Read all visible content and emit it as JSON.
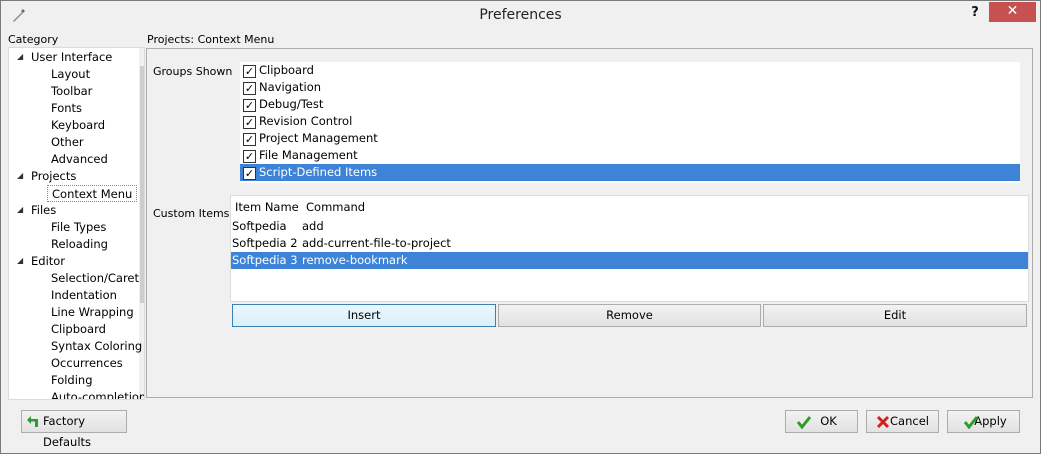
{
  "window": {
    "title": "Preferences",
    "help": "?",
    "close": "✕"
  },
  "category": {
    "label": "Category",
    "items": [
      {
        "text": "User Interface",
        "level": 0,
        "expanded": true
      },
      {
        "text": "Layout",
        "level": 1
      },
      {
        "text": "Toolbar",
        "level": 1
      },
      {
        "text": "Fonts",
        "level": 1
      },
      {
        "text": "Keyboard",
        "level": 1
      },
      {
        "text": "Other",
        "level": 1
      },
      {
        "text": "Advanced",
        "level": 1
      },
      {
        "text": "Projects",
        "level": 0,
        "expanded": true
      },
      {
        "text": "Context Menu",
        "level": 1,
        "selected": true
      },
      {
        "text": "Files",
        "level": 0,
        "expanded": true
      },
      {
        "text": "File Types",
        "level": 1
      },
      {
        "text": "Reloading",
        "level": 1
      },
      {
        "text": "Editor",
        "level": 0,
        "expanded": true
      },
      {
        "text": "Selection/Caret",
        "level": 1
      },
      {
        "text": "Indentation",
        "level": 1
      },
      {
        "text": "Line Wrapping",
        "level": 1
      },
      {
        "text": "Clipboard",
        "level": 1
      },
      {
        "text": "Syntax Coloring",
        "level": 1
      },
      {
        "text": "Occurrences",
        "level": 1
      },
      {
        "text": "Folding",
        "level": 1
      },
      {
        "text": "Auto-completion",
        "level": 1
      }
    ]
  },
  "panel": {
    "title": "Projects: Context Menu",
    "groups_label": "Groups Shown",
    "groups": [
      {
        "text": "Clipboard",
        "checked": true
      },
      {
        "text": "Navigation",
        "checked": true
      },
      {
        "text": "Debug/Test",
        "checked": true
      },
      {
        "text": "Revision Control",
        "checked": true
      },
      {
        "text": "Project Management",
        "checked": true
      },
      {
        "text": "File Management",
        "checked": true
      },
      {
        "text": "Script-Defined Items",
        "checked": true,
        "selected": true
      }
    ],
    "custom_label": "Custom Items",
    "columns": [
      "Item Name",
      "Command"
    ],
    "rows": [
      {
        "name": "Softpedia",
        "command": "add"
      },
      {
        "name": "Softpedia 2",
        "command": "add-current-file-to-project"
      },
      {
        "name": "Softpedia 3",
        "command": "remove-bookmark",
        "selected": true
      }
    ],
    "insert": "Insert",
    "remove": "Remove",
    "edit": "Edit"
  },
  "footer": {
    "factory_defaults": "Factory Defaults",
    "ok": "OK",
    "cancel": "Cancel",
    "apply": "Apply"
  },
  "colors": {
    "selection": "#3d83d7",
    "close": "#c75050",
    "ok_green": "#2e9b2e",
    "cancel_red": "#d0201f"
  }
}
